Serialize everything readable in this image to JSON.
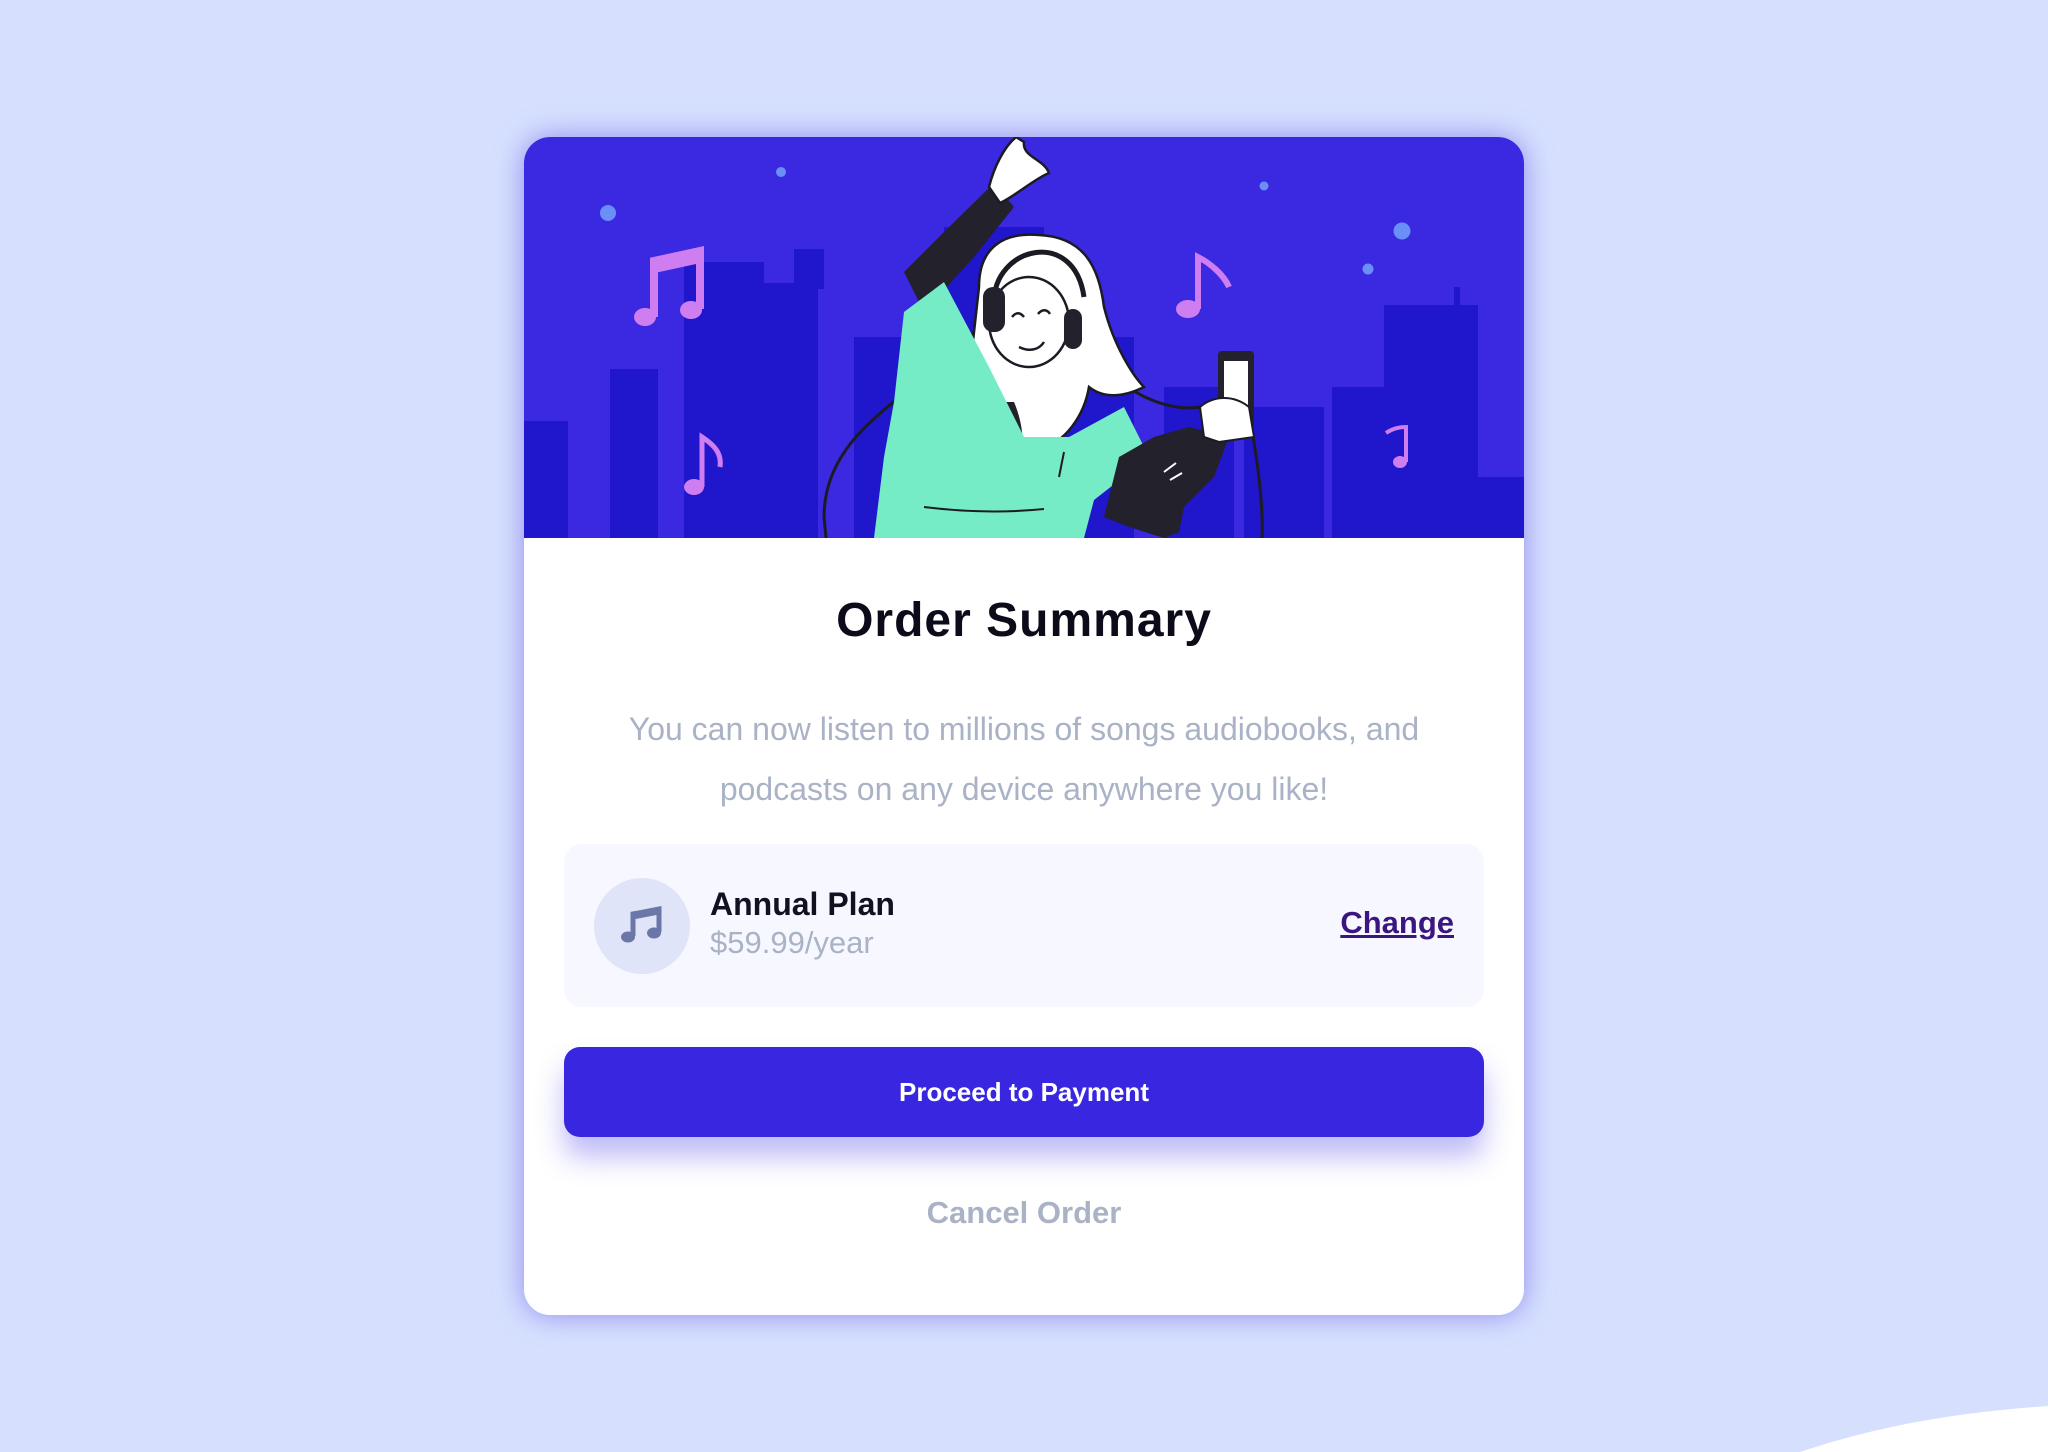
{
  "order": {
    "title": "Order Summary",
    "description": "You can now listen to millions of songs audiobooks, and podcasts on any device anywhere you like!"
  },
  "plan": {
    "icon": "music-note-icon",
    "name": "Annual Plan",
    "price": "$59.99/year",
    "change_label": "Change"
  },
  "actions": {
    "proceed_label": "Proceed to Payment",
    "cancel_label": "Cancel Order"
  },
  "colors": {
    "background": "#d6e0fe",
    "primary": "#3826e0",
    "hero_bg": "#3a29e0",
    "link": "#3b1680",
    "muted_text": "#aab2c6"
  }
}
